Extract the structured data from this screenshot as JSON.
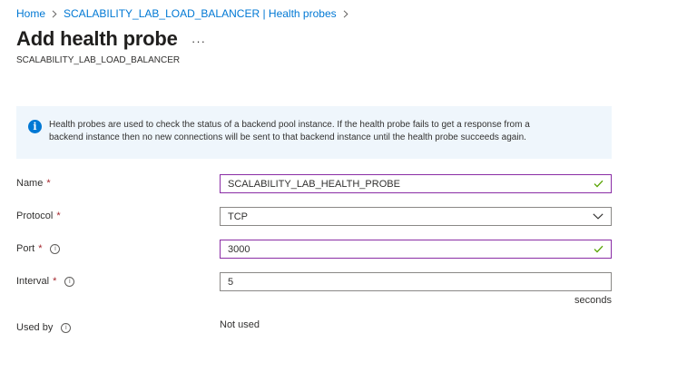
{
  "breadcrumb": {
    "items": [
      "Home",
      "SCALABILITY_LAB_LOAD_BALANCER | Health probes"
    ]
  },
  "header": {
    "title": "Add health probe",
    "more_label": "···",
    "subtitle": "SCALABILITY_LAB_LOAD_BALANCER"
  },
  "info": {
    "icon": "info-icon",
    "line1": "Health probes are used to check the status of a backend pool instance. If the health probe fails to get a response from a",
    "line2": "backend instance then no new connections will be sent to that backend instance until the health probe succeeds again."
  },
  "form": {
    "name": {
      "label": "Name",
      "required": "*",
      "value": "SCALABILITY_LAB_HEALTH_PROBE"
    },
    "protocol": {
      "label": "Protocol",
      "required": "*",
      "value": "TCP"
    },
    "port": {
      "label": "Port",
      "required": "*",
      "value": "3000"
    },
    "interval": {
      "label": "Interval",
      "required": "*",
      "value": "5",
      "units": "seconds"
    },
    "used_by": {
      "label": "Used by",
      "value": "Not used"
    }
  },
  "colors": {
    "link": "#0078d4",
    "required": "#a4262c",
    "valid_border": "#8a2da5",
    "valid_check": "#57a300",
    "banner_bg": "#eff6fc"
  }
}
